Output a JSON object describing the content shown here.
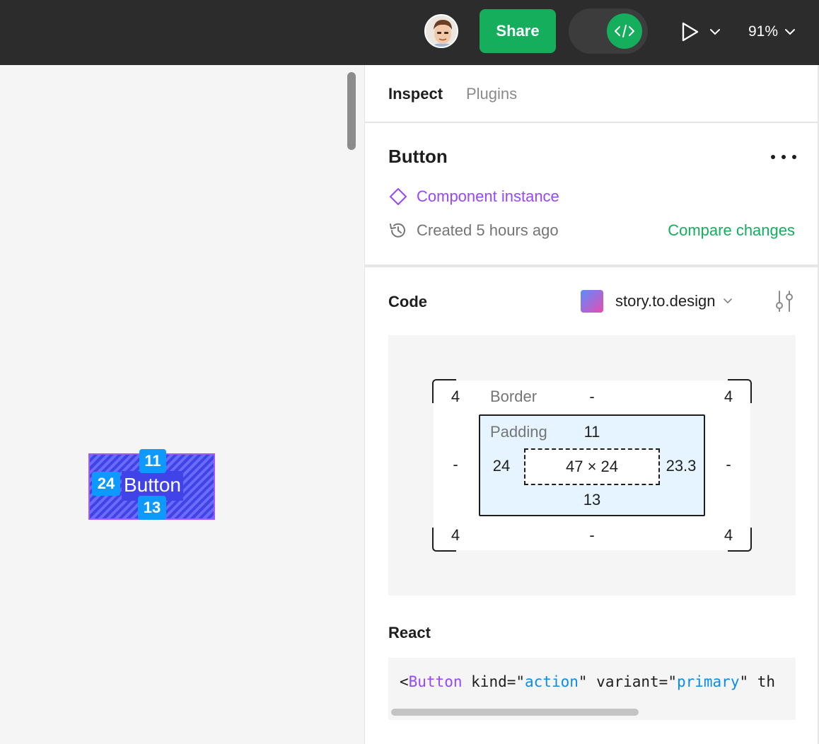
{
  "topbar": {
    "share_label": "Share",
    "zoom": "91%"
  },
  "canvas": {
    "selection_text": "Button",
    "spacing_badges": {
      "top": "11",
      "left": "24",
      "bottom": "13"
    }
  },
  "panel": {
    "tabs": [
      {
        "label": "Inspect",
        "active": true
      },
      {
        "label": "Plugins",
        "active": false
      }
    ],
    "layer_name": "Button",
    "component_label": "Component instance",
    "created_text": "Created 5 hours ago",
    "compare_label": "Compare changes",
    "code_title": "Code",
    "plugin": {
      "name": "story.to.design",
      "logo_text": "story. to. design"
    },
    "box_model": {
      "border_label": "Border",
      "padding_label": "Padding",
      "corner_tl": "4",
      "corner_tr": "4",
      "corner_bl": "4",
      "corner_br": "4",
      "border_top": "-",
      "border_bottom": "-",
      "border_left": "-",
      "border_right": "-",
      "padding_top": "11",
      "padding_left": "24",
      "padding_right": "23.3",
      "padding_bottom": "13",
      "content_size": "47 × 24"
    },
    "react_title": "React",
    "code": {
      "open": "<",
      "tag": "Button",
      "attr1": " kind=\"",
      "val1": "action",
      "attr2": "\" variant=\"",
      "val2": "primary",
      "rest": "\" th"
    }
  },
  "colors": {
    "accent_green": "#14ae5c",
    "component_purple": "#9747ff",
    "spacing_blue": "#0d99ff",
    "topbar_bg": "#2c2c2c"
  }
}
